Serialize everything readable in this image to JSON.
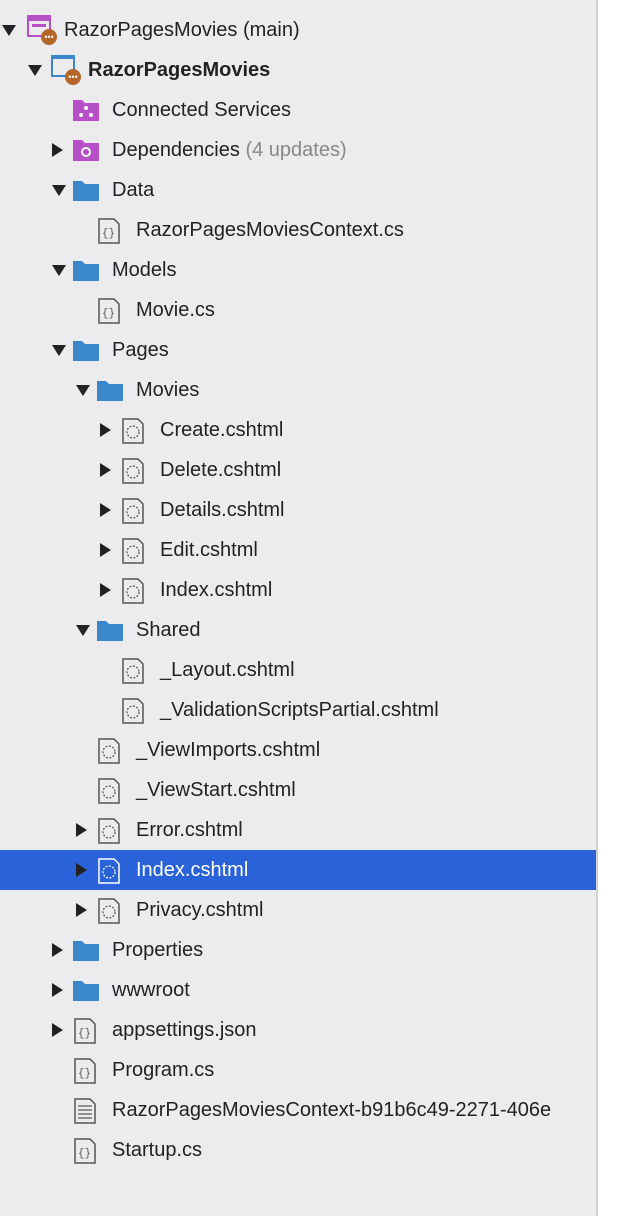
{
  "colors": {
    "selection": "#2962d9",
    "folder": "#3a87cc",
    "project_purple": "#b64fc8",
    "badge": "#b5672a"
  },
  "items": [
    {
      "level": 0,
      "exp": "open",
      "icon": "solution-icon",
      "label": "RazorPagesMovies (main)"
    },
    {
      "level": 1,
      "exp": "open",
      "icon": "project-icon",
      "label": "RazorPagesMovies",
      "bold": true
    },
    {
      "level": 2,
      "exp": "none",
      "icon": "connected-services-icon",
      "label": "Connected Services"
    },
    {
      "level": 2,
      "exp": "closed",
      "icon": "dependencies-icon",
      "label": "Dependencies",
      "suffix": "(4 updates)"
    },
    {
      "level": 2,
      "exp": "open",
      "icon": "folder-icon",
      "label": "Data"
    },
    {
      "level": 3,
      "exp": "none",
      "icon": "csharp-file-icon",
      "label": "RazorPagesMoviesContext.cs"
    },
    {
      "level": 2,
      "exp": "open",
      "icon": "folder-icon",
      "label": "Models"
    },
    {
      "level": 3,
      "exp": "none",
      "icon": "csharp-file-icon",
      "label": "Movie.cs"
    },
    {
      "level": 2,
      "exp": "open",
      "icon": "folder-icon",
      "label": "Pages"
    },
    {
      "level": 3,
      "exp": "open",
      "icon": "folder-icon",
      "label": "Movies"
    },
    {
      "level": 4,
      "exp": "closed",
      "icon": "razor-file-icon",
      "label": "Create.cshtml"
    },
    {
      "level": 4,
      "exp": "closed",
      "icon": "razor-file-icon",
      "label": "Delete.cshtml"
    },
    {
      "level": 4,
      "exp": "closed",
      "icon": "razor-file-icon",
      "label": "Details.cshtml"
    },
    {
      "level": 4,
      "exp": "closed",
      "icon": "razor-file-icon",
      "label": "Edit.cshtml"
    },
    {
      "level": 4,
      "exp": "closed",
      "icon": "razor-file-icon",
      "label": "Index.cshtml"
    },
    {
      "level": 3,
      "exp": "open",
      "icon": "folder-icon",
      "label": "Shared"
    },
    {
      "level": 4,
      "exp": "none",
      "icon": "razor-file-icon",
      "label": "_Layout.cshtml"
    },
    {
      "level": 4,
      "exp": "none",
      "icon": "razor-file-icon",
      "label": "_ValidationScriptsPartial.cshtml"
    },
    {
      "level": 3,
      "exp": "none",
      "icon": "razor-file-icon",
      "label": "_ViewImports.cshtml"
    },
    {
      "level": 3,
      "exp": "none",
      "icon": "razor-file-icon",
      "label": "_ViewStart.cshtml"
    },
    {
      "level": 3,
      "exp": "closed",
      "icon": "razor-file-icon",
      "label": "Error.cshtml"
    },
    {
      "level": 3,
      "exp": "closed",
      "icon": "razor-file-icon",
      "label": "Index.cshtml",
      "selected": true
    },
    {
      "level": 3,
      "exp": "closed",
      "icon": "razor-file-icon",
      "label": "Privacy.cshtml"
    },
    {
      "level": 2,
      "exp": "closed",
      "icon": "folder-icon",
      "label": "Properties"
    },
    {
      "level": 2,
      "exp": "closed",
      "icon": "folder-icon",
      "label": "wwwroot"
    },
    {
      "level": 2,
      "exp": "closed",
      "icon": "json-file-icon",
      "label": "appsettings.json"
    },
    {
      "level": 2,
      "exp": "none",
      "icon": "csharp-file-icon",
      "label": "Program.cs"
    },
    {
      "level": 2,
      "exp": "none",
      "icon": "text-file-icon",
      "label": "RazorPagesMoviesContext-b91b6c49-2271-406e"
    },
    {
      "level": 2,
      "exp": "none",
      "icon": "csharp-file-icon",
      "label": "Startup.cs"
    }
  ]
}
